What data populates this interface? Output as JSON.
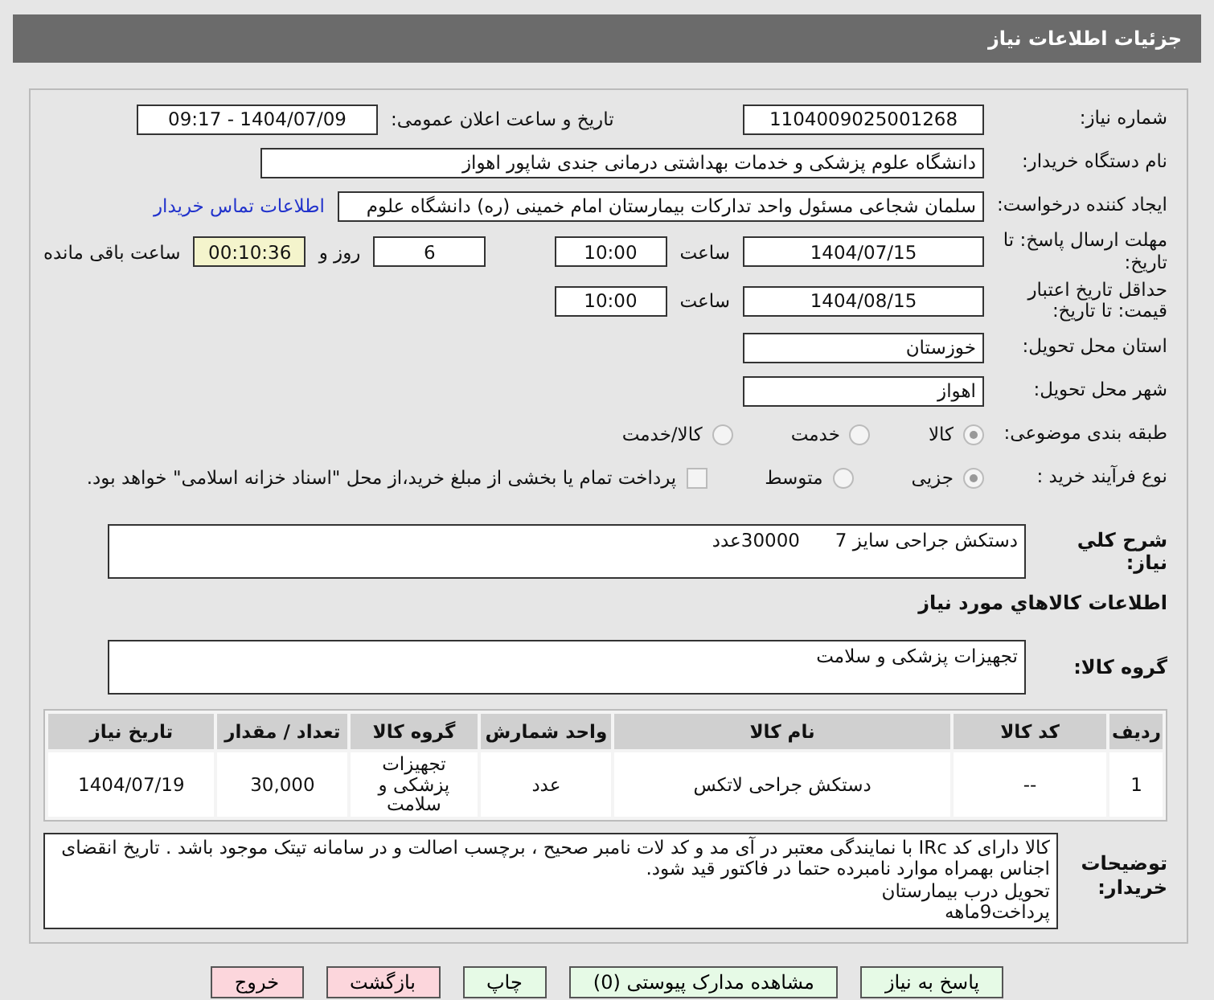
{
  "header": {
    "title": "جزئیات اطلاعات نیاز"
  },
  "fields": {
    "need_number": {
      "label": "شماره نیاز:",
      "value": "1104009025001268"
    },
    "announce": {
      "label": "تاریخ و ساعت اعلان عمومی:",
      "value": "1404/07/09 - 09:17"
    },
    "buyer": {
      "label": "نام دستگاه خریدار:",
      "value": "دانشگاه علوم پزشکی و خدمات بهداشتی درمانی جندی شاپور اهواز"
    },
    "creator": {
      "label": "ایجاد کننده درخواست:",
      "value": "سلمان شجاعی مسئول واحد تدارکات بیمارستان امام خمینی (ره) دانشگاه علوم",
      "link": "اطلاعات تماس خریدار"
    },
    "deadline": {
      "label": "مهلت ارسال پاسخ: تا تاریخ:",
      "date": "1404/07/15",
      "time_label": "ساعت",
      "time": "10:00",
      "days": "6",
      "days_label": "روز و",
      "remaining": "00:10:36",
      "remaining_label": "ساعت باقی مانده"
    },
    "validity": {
      "label": "حداقل تاریخ اعتبار قیمت: تا تاریخ:",
      "date": "1404/08/15",
      "time_label": "ساعت",
      "time": "10:00"
    },
    "province": {
      "label": "استان محل تحویل:",
      "value": "خوزستان"
    },
    "city": {
      "label": "شهر محل تحویل:",
      "value": "اهواز"
    }
  },
  "category": {
    "label": "طبقه بندی موضوعی:",
    "options": [
      {
        "label": "کالا",
        "selected": true
      },
      {
        "label": "خدمت",
        "selected": false
      },
      {
        "label": "کالا/خدمت",
        "selected": false
      }
    ]
  },
  "process": {
    "label": "نوع فرآیند خرید :",
    "options": [
      {
        "label": "جزیی",
        "selected": true
      },
      {
        "label": "متوسط",
        "selected": false
      }
    ],
    "payment": {
      "label": "پرداخت تمام یا بخشی از مبلغ خرید،از محل \"اسناد خزانه اسلامی\" خواهد بود.",
      "checked": false
    }
  },
  "summary": {
    "label": "شرح کلي نياز:",
    "value": "دستکش جراحی سایز 7      30000عدد"
  },
  "goods_title": "اطلاعات کالاهاي مورد نياز",
  "goods_group": {
    "label": "گروه کالا:",
    "value": "تجهیزات پزشکی و سلامت"
  },
  "table": {
    "columns": [
      "ردیف",
      "کد کالا",
      "نام کالا",
      "واحد شمارش",
      "گروه کالا",
      "تعداد / مقدار",
      "تاریخ نیاز"
    ],
    "rows": [
      [
        "1",
        "--",
        "دستکش جراحی لاتکس",
        "عدد",
        "تجهیزات پزشکی و سلامت",
        "30,000",
        "1404/07/19"
      ]
    ]
  },
  "notes": {
    "label": "توضیحات خریدار:",
    "lines": [
      "کالا دارای کد IRc با نمایندگی معتبر در آی مد و کد لات نامبر صحیح ، برچسب اصالت و در سامانه تیتک موجود باشد . تاریخ انقضای اجناس بهمراه موارد نامبرده حتما در فاکتور قید شود.",
      "تحویل درب بیمارستان",
      "پرداخت9ماهه"
    ]
  },
  "buttons": [
    {
      "label": "پاسخ به نیاز",
      "kind": "green"
    },
    {
      "label": "مشاهده مدارک پیوستی (0)",
      "kind": "green"
    },
    {
      "label": "چاپ",
      "kind": "green"
    },
    {
      "label": "بازگشت",
      "kind": "red"
    },
    {
      "label": "خروج",
      "kind": "red"
    }
  ]
}
